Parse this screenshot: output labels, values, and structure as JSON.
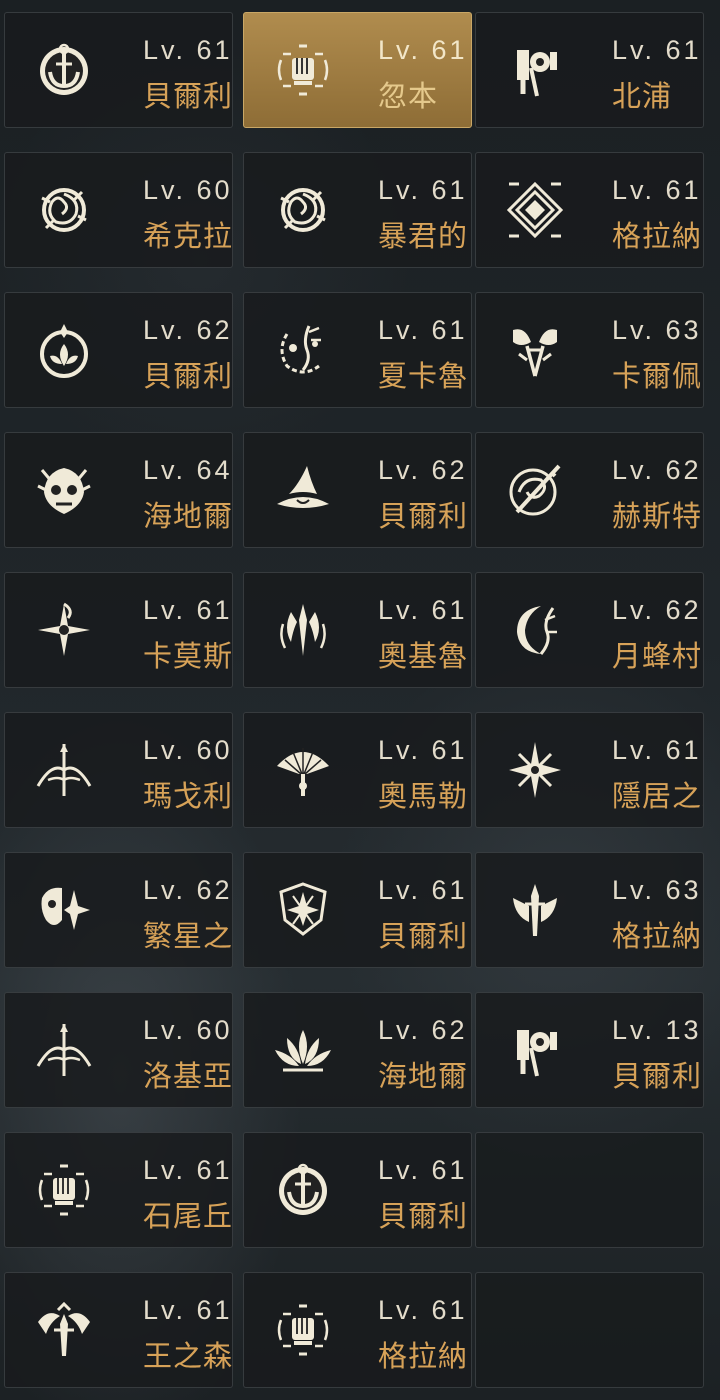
{
  "rows": [
    [
      {
        "level": "Lv. 61",
        "name": "貝爾利",
        "icon": "anchor-moon-icon"
      },
      {
        "level": "Lv. 61",
        "name": "忽本",
        "icon": "fist-emblem-icon",
        "selected": true
      },
      {
        "level": "Lv. 61",
        "name": "北浦",
        "icon": "axe-banner-icon"
      }
    ],
    [
      {
        "level": "Lv. 60",
        "name": "希克拉",
        "icon": "rose-icon"
      },
      {
        "level": "Lv. 61",
        "name": "暴君的",
        "icon": "rose-icon"
      },
      {
        "level": "Lv. 61",
        "name": "格拉納",
        "icon": "diamond-emblem-icon"
      }
    ],
    [
      {
        "level": "Lv. 62",
        "name": "貝爾利",
        "icon": "lotus-circle-icon"
      },
      {
        "level": "Lv. 61",
        "name": "夏卡魯",
        "icon": "thorn-wreath-icon"
      },
      {
        "level": "Lv. 63",
        "name": "卡爾佩烏",
        "icon": "butterfly-axes-icon"
      }
    ],
    [
      {
        "level": "Lv. 64",
        "name": "海地爾",
        "icon": "demon-skull-icon"
      },
      {
        "level": "Lv. 62",
        "name": "貝爾利",
        "icon": "witch-hat-icon"
      },
      {
        "level": "Lv. 62",
        "name": "赫斯特里",
        "icon": "swirl-sword-icon"
      }
    ],
    [
      {
        "level": "Lv. 61",
        "name": "卡莫斯",
        "icon": "star-blade-icon"
      },
      {
        "level": "Lv. 61",
        "name": "奧基魯",
        "icon": "flame-spear-icon"
      },
      {
        "level": "Lv. 62",
        "name": "月蜂村莊",
        "icon": "moon-branch-icon"
      }
    ],
    [
      {
        "level": "Lv. 60",
        "name": "瑪戈利",
        "icon": "bow-icon"
      },
      {
        "level": "Lv. 61",
        "name": "奧馬勒",
        "icon": "fan-icon"
      },
      {
        "level": "Lv. 61",
        "name": "隱居之森",
        "icon": "compass-star-icon"
      }
    ],
    [
      {
        "level": "Lv. 62",
        "name": "繁星之",
        "icon": "helm-star-icon"
      },
      {
        "level": "Lv. 61",
        "name": "貝爾利",
        "icon": "shield-star-icon"
      },
      {
        "level": "Lv. 63",
        "name": "格拉納",
        "icon": "winged-sword-icon"
      }
    ],
    [
      {
        "level": "Lv. 60",
        "name": "洛基亞",
        "icon": "bow-icon"
      },
      {
        "level": "Lv. 62",
        "name": "海地爾",
        "icon": "lotus-icon"
      },
      {
        "level": "Lv. 13",
        "name": "貝爾利亞",
        "icon": "axe-banner-icon"
      }
    ],
    [
      {
        "level": "Lv. 61",
        "name": "石尾丘",
        "icon": "fist-emblem-icon"
      },
      {
        "level": "Lv. 61",
        "name": "貝爾利",
        "icon": "anchor-moon-icon"
      },
      null
    ],
    [
      {
        "level": "Lv. 61",
        "name": "王之森",
        "icon": "crowned-sword-icon"
      },
      {
        "level": "Lv. 61",
        "name": "格拉納",
        "icon": "fist-emblem-icon"
      },
      null
    ]
  ]
}
